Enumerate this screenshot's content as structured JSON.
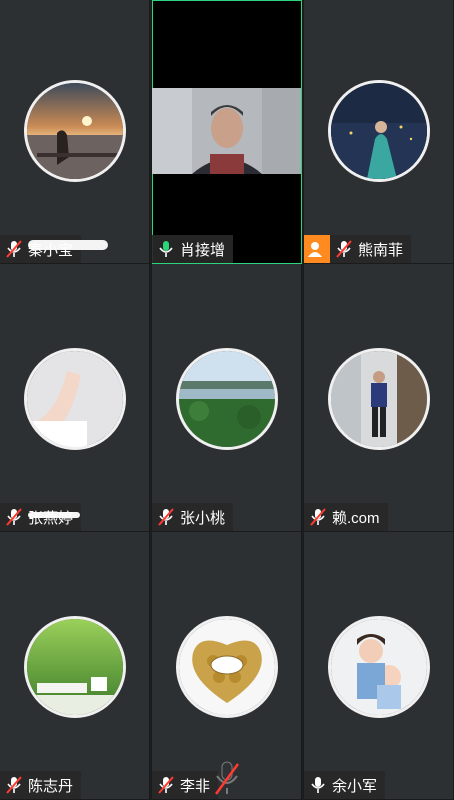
{
  "participants": [
    {
      "name": "秦小宝",
      "mic": "muted",
      "avatar": "sunset-woman-photo"
    },
    {
      "name": "肖接增",
      "mic": "on",
      "avatar": "live-video"
    },
    {
      "name": "熊南菲",
      "mic": "muted",
      "avatar": "night-woman-photo",
      "badge": "person-icon"
    },
    {
      "name": "张燕婷",
      "mic": "muted",
      "avatar": "arm-stretch-photo"
    },
    {
      "name": "张小桃",
      "mic": "muted",
      "avatar": "lake-landscape-photo"
    },
    {
      "name": "赖.com",
      "mic": "muted",
      "avatar": "man-standing-photo"
    },
    {
      "name": "陈志丹",
      "mic": "muted",
      "avatar": "book-coffee-photo"
    },
    {
      "name": "李非",
      "mic": "muted",
      "avatar": "ferrero-rocher-photo"
    },
    {
      "name": "余小军",
      "mic": "on",
      "avatar": "kids-photo"
    }
  ],
  "colors": {
    "tile_bg": "#2d3033",
    "active_border": "#2bd67a",
    "mic_on": "#2bd67a",
    "mic_muted": "#ff3b30",
    "badge": "#ff8a1f"
  },
  "floating_mic": "muted"
}
